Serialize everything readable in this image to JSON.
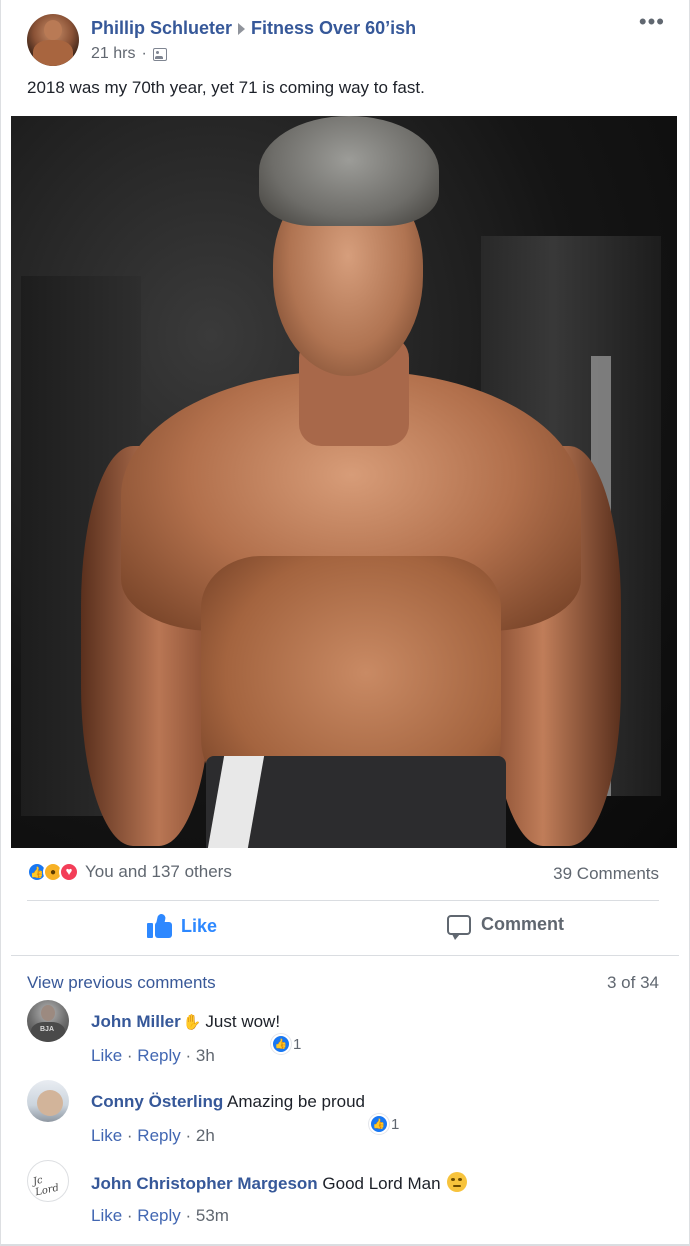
{
  "post": {
    "author": "Phillip Schlueter",
    "group": "Fitness Over 60’ish",
    "time": "21 hrs",
    "separator": "·",
    "text": "2018 was my 70th year, yet 71 is coming way to fast.",
    "more_label": "•••"
  },
  "reactions": {
    "summary": "You and 137 others",
    "comments_count": "39 Comments",
    "types": [
      "like-icon",
      "wow-icon",
      "love-icon"
    ]
  },
  "actions": {
    "like_label": "Like",
    "comment_label": "Comment"
  },
  "comments_section": {
    "view_previous": "View previous comments",
    "page_count": "3 of 34",
    "items": [
      {
        "name": "John Miller",
        "text": "Just wow!",
        "like": "Like",
        "reply": "Reply",
        "time": "3h",
        "reaction_count": "1"
      },
      {
        "name": "Conny Österling",
        "text": "Amazing be proud",
        "like": "Like",
        "reply": "Reply",
        "time": "2h",
        "reaction_count": "1"
      },
      {
        "name": "John Christopher Margeson",
        "text": "Good Lord Man",
        "like": "Like",
        "reply": "Reply",
        "time": "53m"
      }
    ]
  },
  "colors": {
    "link_blue": "#365899",
    "like_blue": "#2d88ff",
    "meta_gray": "#606770"
  }
}
